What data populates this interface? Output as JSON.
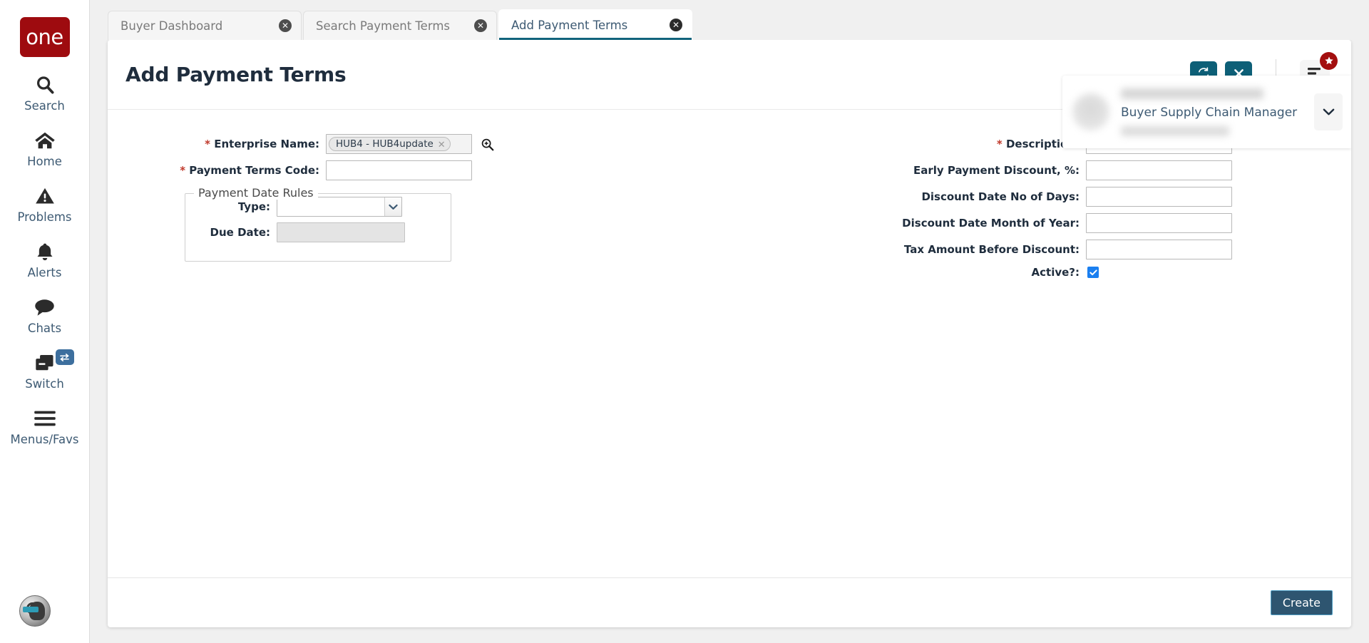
{
  "brand": {
    "logo_text": "one"
  },
  "sidebar": {
    "items": [
      {
        "label": "Search",
        "icon": "search-icon"
      },
      {
        "label": "Home",
        "icon": "home-icon"
      },
      {
        "label": "Problems",
        "icon": "warning-triangle-icon"
      },
      {
        "label": "Alerts",
        "icon": "bell-icon"
      },
      {
        "label": "Chats",
        "icon": "chat-bubble-icon"
      },
      {
        "label": "Switch",
        "icon": "switch-windows-icon",
        "badge_icon": "swap-arrows-icon"
      },
      {
        "label": "Menus/Favs",
        "icon": "hamburger-icon"
      }
    ],
    "assistant_icon": "ai-assistant-avatar-icon"
  },
  "tabs": [
    {
      "label": "Buyer Dashboard",
      "active": false,
      "close_icon": "close-circle-icon"
    },
    {
      "label": "Search Payment Terms",
      "active": false,
      "close_icon": "close-circle-icon"
    },
    {
      "label": "Add Payment Terms",
      "active": true,
      "close_icon": "close-circle-icon"
    }
  ],
  "header": {
    "title": "Add Payment Terms",
    "refresh_icon": "refresh-icon",
    "close_icon": "close-x-icon",
    "menu_icon": "list-menu-icon",
    "badge_icon": "star-icon"
  },
  "user": {
    "role": "Buyer Supply Chain Manager",
    "caret_icon": "chevron-down-icon",
    "avatar_icon": "avatar"
  },
  "form": {
    "left": {
      "enterprise_name": {
        "label": "Enterprise Name:",
        "required": true,
        "chip_value": "HUB4 - HUB4update",
        "chip_remove_icon": "close-x-icon",
        "lookup_icon": "search-plus-icon"
      },
      "payment_terms_code": {
        "label": "Payment Terms Code:",
        "required": true,
        "value": "",
        "placeholder": ""
      },
      "payment_date_rules": {
        "legend": "Payment Date Rules",
        "type": {
          "label": "Type:",
          "required": false,
          "value": "",
          "caret_icon": "chevron-down-icon",
          "options": []
        },
        "due_date": {
          "label": "Due Date:",
          "required": false,
          "value": "",
          "disabled": true
        }
      }
    },
    "right": {
      "description": {
        "label": "Description:",
        "required": true,
        "value": "",
        "placeholder": ""
      },
      "early_payment_discount": {
        "label": "Early Payment Discount, %:",
        "required": false,
        "value": "",
        "placeholder": ""
      },
      "discount_date_no_of_days": {
        "label": "Discount Date No of Days:",
        "required": false,
        "value": "",
        "placeholder": ""
      },
      "discount_date_month_of_year": {
        "label": "Discount Date Month of Year:",
        "required": false,
        "value": "",
        "placeholder": ""
      },
      "tax_amount_before_discount": {
        "label": "Tax Amount Before Discount:",
        "required": false,
        "value": "",
        "placeholder": ""
      },
      "active": {
        "label": "Active?:",
        "checked": true,
        "check_icon": "checkmark-icon"
      }
    }
  },
  "footer": {
    "create_label": "Create"
  },
  "colors": {
    "brand_red": "#9e0b0f",
    "teal_action": "#0d5f77",
    "tab_active_underline": "#12647c",
    "create_button": "#2e5570",
    "required_star": "#c0392b",
    "checkbox_blue": "#1a7ff0",
    "label_text": "#1f2d3d",
    "link_text": "#3d5a73"
  }
}
